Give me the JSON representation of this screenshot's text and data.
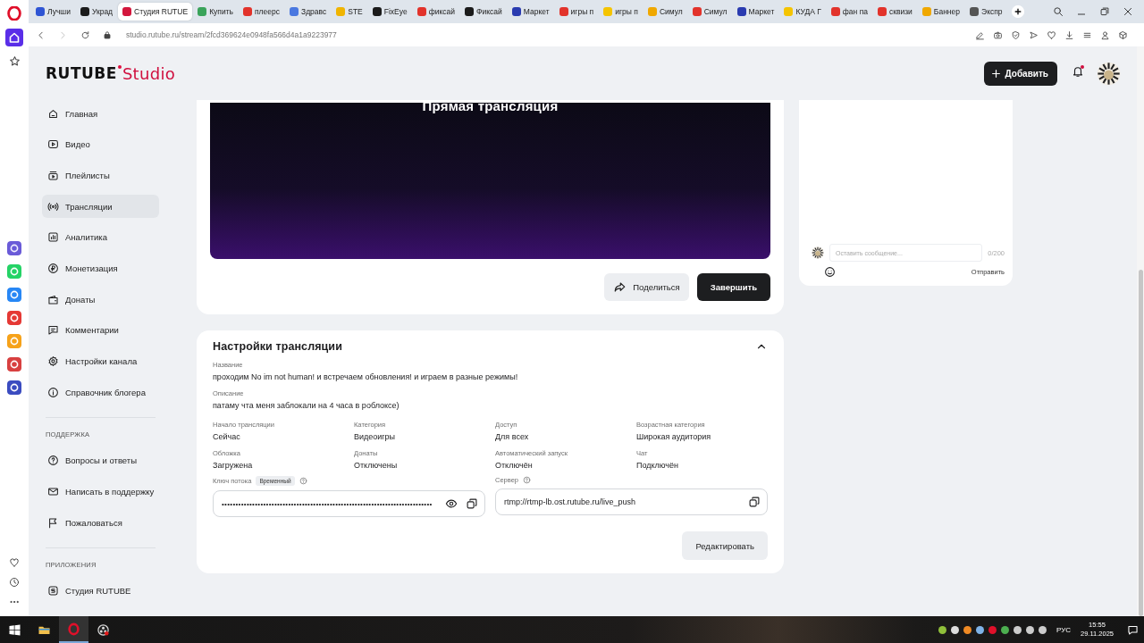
{
  "browser": {
    "tabs": [
      {
        "label": "Лучши",
        "color": "#2f55d4",
        "selected": false
      },
      {
        "label": "Украд",
        "color": "#1b1b1b",
        "selected": false
      },
      {
        "label": "Студия RUTUE",
        "color": "#d3173d",
        "selected": true
      },
      {
        "label": "Купить",
        "color": "#3aa35a",
        "selected": false
      },
      {
        "label": "плеерс",
        "color": "#e2332b",
        "selected": false
      },
      {
        "label": "Здравс",
        "color": "#4a78e0",
        "selected": false
      },
      {
        "label": "STE",
        "color": "#f0b400",
        "selected": false
      },
      {
        "label": "FixEye",
        "color": "#1b1b1b",
        "selected": false
      },
      {
        "label": "фиксай",
        "color": "#e2332b",
        "selected": false
      },
      {
        "label": "Фиксай",
        "color": "#1b1b1b",
        "selected": false
      },
      {
        "label": "Маркет",
        "color": "#2a3bb0",
        "selected": false
      },
      {
        "label": "игры п",
        "color": "#e2332b",
        "selected": false
      },
      {
        "label": "игры п",
        "color": "#f5c400",
        "selected": false
      },
      {
        "label": "Симул",
        "color": "#f0a800",
        "selected": false
      },
      {
        "label": "Симул",
        "color": "#e2332b",
        "selected": false
      },
      {
        "label": "Маркет",
        "color": "#2a3bb0",
        "selected": false
      },
      {
        "label": "КУДА Г",
        "color": "#f5c400",
        "selected": false
      },
      {
        "label": "фан па",
        "color": "#e2332b",
        "selected": false
      },
      {
        "label": "сквизи",
        "color": "#e2332b",
        "selected": false
      },
      {
        "label": "Баннер",
        "color": "#f0a800",
        "selected": false
      },
      {
        "label": "Экспр",
        "color": "#555555",
        "selected": false
      }
    ],
    "address": "studio.rutube.ru/stream/2fcd369624e0948fa566d4a1a9223977"
  },
  "header": {
    "logo": "RUTUBE",
    "logo_suffix": "Studio",
    "add_button": "Добавить",
    "unread": true
  },
  "sidebar": {
    "items": [
      {
        "label": "Главная",
        "selected": false
      },
      {
        "label": "Видео",
        "selected": false
      },
      {
        "label": "Плейлисты",
        "selected": false
      },
      {
        "label": "Трансляции",
        "selected": true
      },
      {
        "label": "Аналитика",
        "selected": false
      },
      {
        "label": "Монетизация",
        "selected": false
      },
      {
        "label": "Донаты",
        "selected": false
      },
      {
        "label": "Комментарии",
        "selected": false
      },
      {
        "label": "Настройки канала",
        "selected": false
      },
      {
        "label": "Справочник блогера",
        "selected": false
      }
    ],
    "sections": [
      {
        "title": "ПОДДЕРЖКА",
        "items": [
          {
            "label": "Вопросы и ответы",
            "selected": false
          },
          {
            "label": "Написать в поддержку",
            "selected": false
          },
          {
            "label": "Пожаловаться",
            "selected": false
          }
        ]
      },
      {
        "title": "ПРИЛОЖЕНИЯ",
        "items": [
          {
            "label": "Студия RUTUBE",
            "selected": false
          }
        ]
      }
    ]
  },
  "player": {
    "title": "Прямая трансляция",
    "buttons": [
      {
        "label": "Поделиться",
        "kind": "secondary"
      },
      {
        "label": "Завершить",
        "kind": "primary"
      }
    ]
  },
  "settings": {
    "title": "Настройки трансляции",
    "expanded": true,
    "name": {
      "label": "Название",
      "value": "проходим No im not human! и встречаем обновления! и играем в разные режимы!"
    },
    "description": {
      "label": "Описание",
      "value": "патаму чта меня заблокали на 4 часа в роблоксе)"
    },
    "fields": [
      {
        "label": "Начало трансляции",
        "value": "Сейчас"
      },
      {
        "label": "Категория",
        "value": "Видеоигры"
      },
      {
        "label": "Доступ",
        "value": "Для всех"
      },
      {
        "label": "Возрастная категория",
        "value": "Широкая аудитория"
      },
      {
        "label": "Обложка",
        "value": "Загружена"
      },
      {
        "label": "Донаты",
        "value": "Отключены"
      },
      {
        "label": "Автоматический запуск",
        "value": "Отключён"
      },
      {
        "label": "Чат",
        "value": "Подключён"
      }
    ],
    "stream_key": {
      "label": "Ключ потока",
      "badge": "Временный",
      "value": "••••••••••••••••••••••••••••••••••••••••••••••••••••••••••••••••••••••••••••"
    },
    "server": {
      "label": "Сервер",
      "value": "rtmp://rtmp-lb.ost.rutube.ru/live_push"
    },
    "edit_button": "Редактировать"
  },
  "chat": {
    "placeholder": "Оставить сообщение...",
    "counter": "0/200",
    "send": "Отправить"
  },
  "taskbar": {
    "apps": [
      {
        "active": false
      },
      {
        "active": false
      },
      {
        "active": true
      },
      {
        "active": false
      }
    ],
    "language": "РУС",
    "time": "15:55",
    "date": "29.11.2025"
  }
}
